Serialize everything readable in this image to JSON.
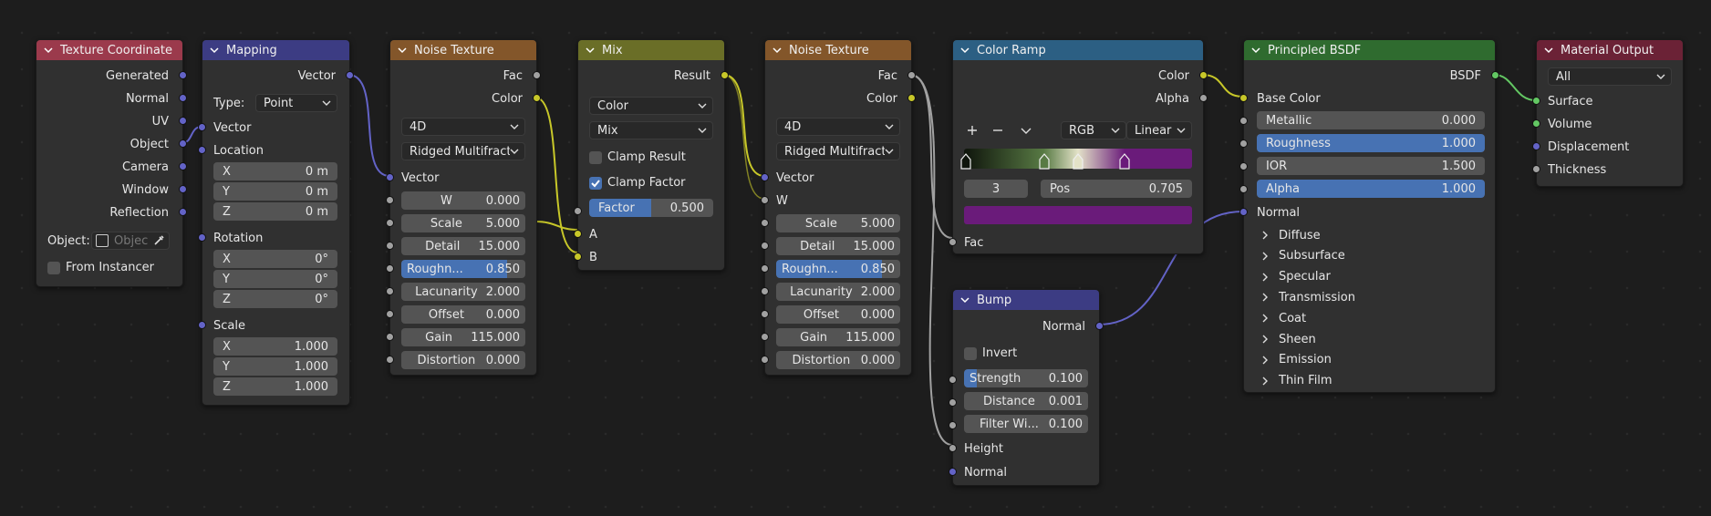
{
  "colors": {
    "float": "#a1a1a1",
    "vector": "#6363c7",
    "color": "#c7c729",
    "shader": "#63c763",
    "slider_fill": "#4772b3"
  },
  "icons": [
    "chevron-down-icon",
    "dropdown-arrow-icon",
    "checkbox-icon",
    "eyedropper-icon",
    "plus-icon",
    "minus-icon",
    "chevron-right-icon"
  ],
  "texture_coordinate": {
    "title": "Texture Coordinate",
    "outputs": [
      "Generated",
      "Normal",
      "UV",
      "Object",
      "Camera",
      "Window",
      "Reflection"
    ],
    "object_label": "Object:",
    "object_placeholder": "Objec",
    "from_instancer": "From Instancer"
  },
  "mapping": {
    "title": "Mapping",
    "output": "Vector",
    "type_label": "Type:",
    "type_value": "Point",
    "vector_label": "Vector",
    "location_label": "Location",
    "location": [
      {
        "axis": "X",
        "value": "0 m"
      },
      {
        "axis": "Y",
        "value": "0 m"
      },
      {
        "axis": "Z",
        "value": "0 m"
      }
    ],
    "rotation_label": "Rotation",
    "rotation": [
      {
        "axis": "X",
        "value": "0°"
      },
      {
        "axis": "Y",
        "value": "0°"
      },
      {
        "axis": "Z",
        "value": "0°"
      }
    ],
    "scale_label": "Scale",
    "scale": [
      {
        "axis": "X",
        "value": "1.000"
      },
      {
        "axis": "Y",
        "value": "1.000"
      },
      {
        "axis": "Z",
        "value": "1.000"
      }
    ]
  },
  "noise1": {
    "title": "Noise Texture",
    "outputs": [
      "Fac",
      "Color"
    ],
    "dimensions": "4D",
    "type": "Ridged Multifractal",
    "vector_label": "Vector",
    "params": [
      {
        "label": "W",
        "value": "0.000"
      },
      {
        "label": "Scale",
        "value": "5.000"
      },
      {
        "label": "Detail",
        "value": "15.000"
      },
      {
        "label": "Roughn...",
        "value": "0.850",
        "fill": 0.85
      },
      {
        "label": "Lacunarity",
        "value": "2.000"
      },
      {
        "label": "Offset",
        "value": "0.000"
      },
      {
        "label": "Gain",
        "value": "115.000"
      },
      {
        "label": "Distortion",
        "value": "0.000"
      }
    ]
  },
  "mix": {
    "title": "Mix",
    "output": "Result",
    "data_type": "Color",
    "blend_mode": "Mix",
    "clamp_result": "Clamp Result",
    "clamp_factor": "Clamp Factor",
    "factor_label": "Factor",
    "factor_value": "0.500",
    "factor_fill": 0.5,
    "input_a": "A",
    "input_b": "B"
  },
  "noise2": {
    "title": "Noise Texture",
    "outputs": [
      "Fac",
      "Color"
    ],
    "dimensions": "4D",
    "type": "Ridged Multifractal",
    "vector_label": "Vector",
    "w_label": "W",
    "params": [
      {
        "label": "Scale",
        "value": "5.000"
      },
      {
        "label": "Detail",
        "value": "15.000"
      },
      {
        "label": "Roughn...",
        "value": "0.850",
        "fill": 0.85
      },
      {
        "label": "Lacunarity",
        "value": "2.000"
      },
      {
        "label": "Offset",
        "value": "0.000"
      },
      {
        "label": "Gain",
        "value": "115.000"
      },
      {
        "label": "Distortion",
        "value": "0.000"
      }
    ]
  },
  "color_ramp": {
    "title": "Color Ramp",
    "outputs": [
      "Color",
      "Alpha"
    ],
    "color_mode": "RGB",
    "interpolation": "Linear",
    "stop_index": "3",
    "pos_label": "Pos",
    "pos_value": "0.705",
    "selected_color": "#6a1b7a",
    "fac_label": "Fac",
    "stops": [
      {
        "position": 0.0,
        "color": "#0f150c"
      },
      {
        "position": 0.35,
        "color": "#587a44"
      },
      {
        "position": 0.5,
        "color": "#e3e2c8"
      },
      {
        "position": 0.705,
        "color": "#6a1b7a"
      }
    ]
  },
  "bump": {
    "title": "Bump",
    "output": "Normal",
    "invert": "Invert",
    "params": [
      {
        "label": "Strength",
        "value": "0.100",
        "fill": 0.1
      },
      {
        "label": "Distance",
        "value": "0.001"
      },
      {
        "label": "Filter Wi...",
        "value": "0.100"
      }
    ],
    "height_label": "Height",
    "normal_label": "Normal"
  },
  "principled": {
    "title": "Principled BSDF",
    "output": "BSDF",
    "base_color": "Base Color",
    "params": [
      {
        "label": "Metallic",
        "value": "0.000"
      },
      {
        "label": "Roughness",
        "value": "1.000",
        "fill": 1.0
      },
      {
        "label": "IOR",
        "value": "1.500"
      },
      {
        "label": "Alpha",
        "value": "1.000",
        "fill": 1.0
      }
    ],
    "normal_label": "Normal",
    "panels": [
      "Diffuse",
      "Subsurface",
      "Specular",
      "Transmission",
      "Coat",
      "Sheen",
      "Emission",
      "Thin Film"
    ]
  },
  "material_output": {
    "title": "Material Output",
    "target": "All",
    "inputs": [
      "Surface",
      "Volume",
      "Displacement",
      "Thickness"
    ]
  }
}
